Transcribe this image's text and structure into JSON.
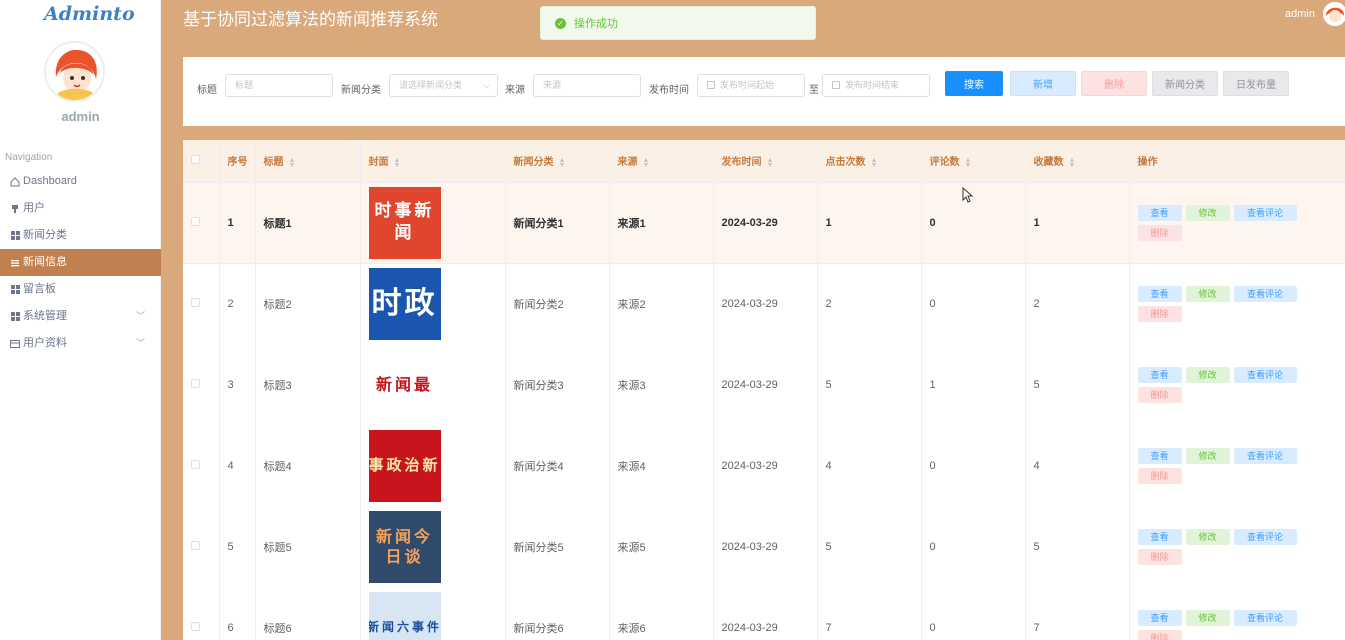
{
  "app": {
    "logo": "Adminto",
    "title": "基于协同过滤算法的新闻推荐系统",
    "toast": "操作成功",
    "top_user": "admin"
  },
  "sidebar": {
    "username": "admin",
    "nav_title": "Navigation",
    "items": [
      {
        "label": "Dashboard",
        "icon": "home-icon"
      },
      {
        "label": "用户",
        "icon": "user-icon"
      },
      {
        "label": "新闻分类",
        "icon": "grid-icon"
      },
      {
        "label": "新闻信息",
        "icon": "list-icon"
      },
      {
        "label": "留言板",
        "icon": "grid-icon"
      },
      {
        "label": "系统管理",
        "icon": "grid-icon"
      },
      {
        "label": "用户资料",
        "icon": "card-icon"
      }
    ]
  },
  "search": {
    "title_label": "标题",
    "title_placeholder": "标题",
    "category_label": "新闻分类",
    "category_placeholder": "请选择新闻分类",
    "source_label": "来源",
    "source_placeholder": "来源",
    "date_label": "发布时间",
    "date_start_placeholder": "发布时间起始",
    "date_sep": "至",
    "date_end_placeholder": "发布时间结束",
    "buttons": {
      "search": "搜索",
      "add": "新增",
      "delete": "删除",
      "category": "新闻分类",
      "daily": "日发布量"
    }
  },
  "table": {
    "headers": {
      "index": "序号",
      "title": "标题",
      "cover": "封面",
      "category": "新闻分类",
      "source": "来源",
      "date": "发布时间",
      "clicks": "点击次数",
      "comments": "评论数",
      "favorites": "收藏数",
      "actions": "操作"
    },
    "actions": {
      "view": "查看",
      "edit": "修改",
      "comments": "查看评论",
      "delete": "删除"
    },
    "rows": [
      {
        "index": "1",
        "title": "标题1",
        "cover": "时事新闻",
        "category": "新闻分类1",
        "source": "来源1",
        "date": "2024-03-29",
        "clicks": "1",
        "comments": "0",
        "favorites": "1"
      },
      {
        "index": "2",
        "title": "标题2",
        "cover": "时政",
        "category": "新闻分类2",
        "source": "来源2",
        "date": "2024-03-29",
        "clicks": "2",
        "comments": "0",
        "favorites": "2"
      },
      {
        "index": "3",
        "title": "标题3",
        "cover": "新闻最",
        "category": "新闻分类3",
        "source": "来源3",
        "date": "2024-03-29",
        "clicks": "5",
        "comments": "1",
        "favorites": "5"
      },
      {
        "index": "4",
        "title": "标题4",
        "cover": "时事政治新闻",
        "category": "新闻分类4",
        "source": "来源4",
        "date": "2024-03-29",
        "clicks": "4",
        "comments": "0",
        "favorites": "4"
      },
      {
        "index": "5",
        "title": "标题5",
        "cover": "新闻今日谈",
        "category": "新闻分类5",
        "source": "来源5",
        "date": "2024-03-29",
        "clicks": "5",
        "comments": "0",
        "favorites": "5"
      },
      {
        "index": "6",
        "title": "标题6",
        "cover": "新闻六事件",
        "category": "新闻分类6",
        "source": "来源6",
        "date": "2024-03-29",
        "clicks": "7",
        "comments": "0",
        "favorites": "7"
      }
    ]
  }
}
